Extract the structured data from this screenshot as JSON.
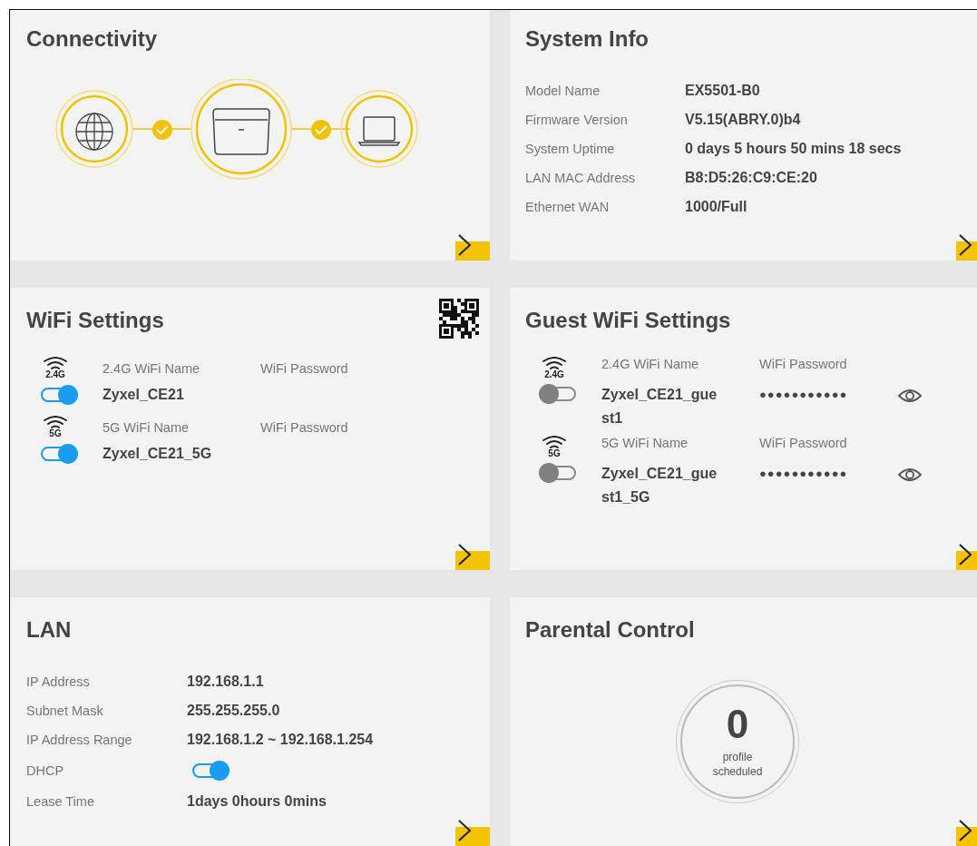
{
  "connectivity": {
    "title": "Connectivity"
  },
  "system_info": {
    "title": "System Info",
    "rows": [
      {
        "label": "Model Name",
        "value": "EX5501-B0"
      },
      {
        "label": "Firmware Version",
        "value": "V5.15(ABRY.0)b4"
      },
      {
        "label": "System Uptime",
        "value": "0 days 5 hours 50 mins 18 secs"
      },
      {
        "label": "LAN MAC Address",
        "value": "B8:D5:26:C9:CE:20"
      },
      {
        "label": "Ethernet WAN",
        "value": "1000/Full"
      }
    ]
  },
  "wifi_settings": {
    "title": "WiFi Settings",
    "bands": [
      {
        "band": "2.4G",
        "name_label": "2.4G WiFi Name",
        "password_label": "WiFi Password",
        "enabled": true,
        "ssid": "Zyxel_CE21"
      },
      {
        "band": "5G",
        "name_label": "5G WiFi Name",
        "password_label": "WiFi Password",
        "enabled": true,
        "ssid": "Zyxel_CE21_5G"
      }
    ]
  },
  "guest_wifi_settings": {
    "title": "Guest WiFi Settings",
    "bands": [
      {
        "band": "2.4G",
        "name_label": "2.4G WiFi Name",
        "password_label": "WiFi Password",
        "enabled": false,
        "ssid": "Zyxel_CE21_guest1",
        "password": "●●●●●●●●●●●"
      },
      {
        "band": "5G",
        "name_label": "5G WiFi Name",
        "password_label": "WiFi Password",
        "enabled": false,
        "ssid": "Zyxel_CE21_guest1_5G",
        "password": "●●●●●●●●●●●"
      }
    ]
  },
  "lan": {
    "title": "LAN",
    "rows": [
      {
        "kind": "text",
        "label": "IP Address",
        "value": "192.168.1.1"
      },
      {
        "kind": "text",
        "label": "Subnet Mask",
        "value": "255.255.255.0"
      },
      {
        "kind": "text",
        "label": "IP Address Range",
        "value": "192.168.1.2 ~ 192.168.1.254"
      },
      {
        "kind": "toggle",
        "label": "DHCP",
        "on": true
      },
      {
        "kind": "text",
        "label": "Lease Time",
        "value": "1days 0hours 0mins"
      }
    ]
  },
  "parental_control": {
    "title": "Parental Control",
    "count": "0",
    "caption": "profile scheduled"
  }
}
